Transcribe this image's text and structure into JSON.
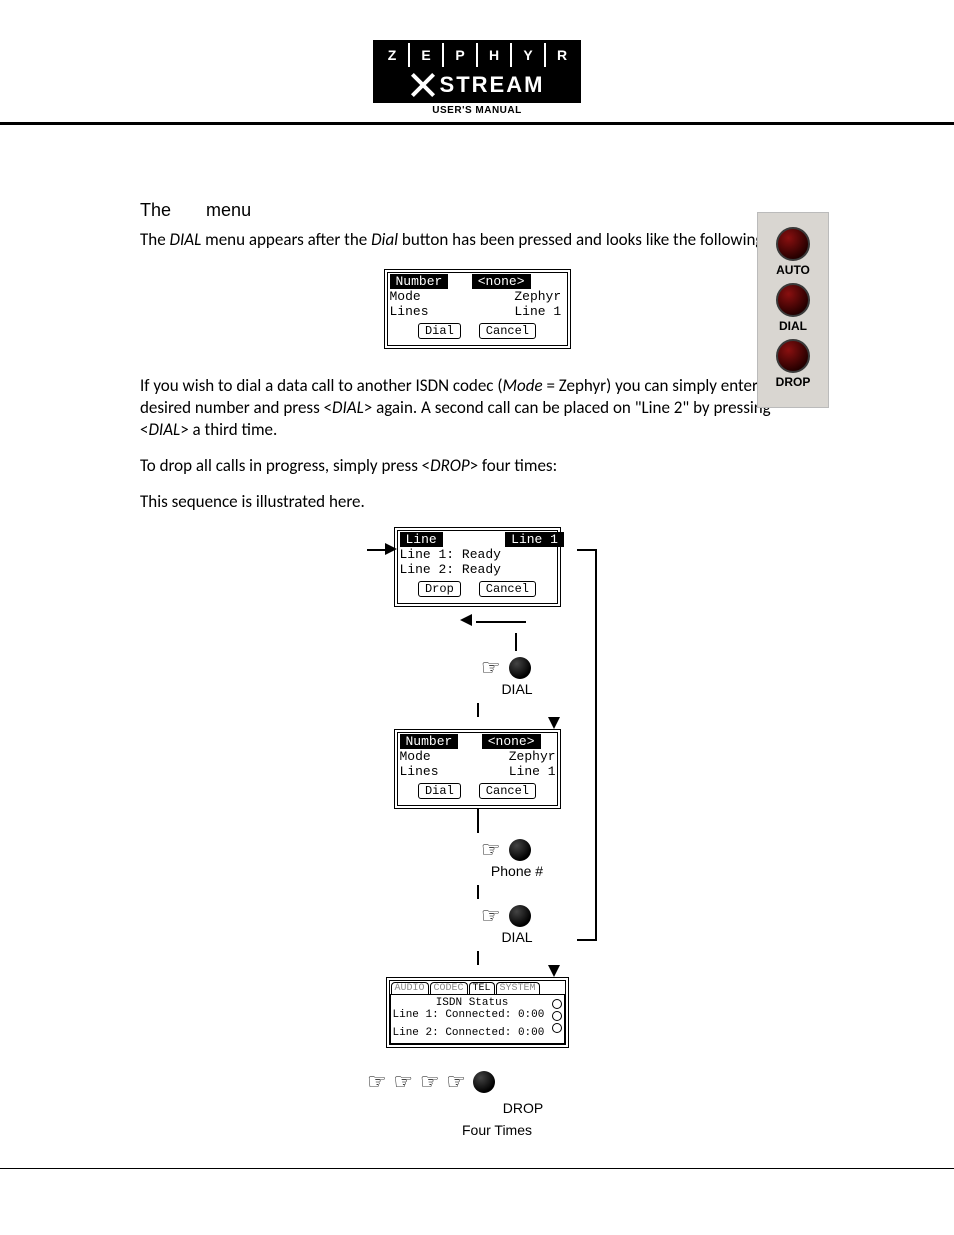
{
  "logo": {
    "letters": "ZEPHYR",
    "brand": "STREAM",
    "subtitle": "USER'S MANUAL"
  },
  "heading": {
    "the": "The",
    "menu": "menu"
  },
  "para1_a": "The ",
  "para1_b": "DIAL",
  "para1_c": " menu appears after the ",
  "para1_d": "Dial",
  "para1_e": " button has been pressed and looks like the following:",
  "lcd1": {
    "number_lbl": "Number",
    "number_val": "<none>",
    "mode_lbl": "Mode",
    "mode_val": "Zephyr",
    "lines_lbl": "Lines",
    "lines_val": "Line 1",
    "dial": "Dial",
    "cancel": "Cancel"
  },
  "side": {
    "auto": "AUTO",
    "dial": "DIAL",
    "drop": "DROP"
  },
  "para2_a": "If you wish to dial a data call to another ISDN codec (",
  "para2_b": "Mode",
  "para2_c": " = Zephyr) you can simply enter the desired number and press <",
  "para2_d": "DIAL",
  "para2_e": "> again.  A second call can be placed on \"Line 2\" by pressing <",
  "para2_f": "DIAL",
  "para2_g": "> a third time.",
  "para3_a": "To drop all calls in progress, simply press <",
  "para3_b": "DROP",
  "para3_c": "> four times:",
  "para4": "This sequence is illustrated here.",
  "flow": {
    "lcd_top": {
      "line_lbl": "Line",
      "line_val": "Line 1",
      "l1": "Line 1:",
      "l1v": "Ready",
      "l2": "Line 2:",
      "l2v": "Ready",
      "drop": "Drop",
      "cancel": "Cancel"
    },
    "step_dial": "DIAL",
    "step_phone": "Phone #",
    "lcd_status": {
      "tab_audio": "AUDIO",
      "tab_codec": "CODEC",
      "tab_tel": "TEL",
      "tab_system": "SYSTEM",
      "title": "ISDN Status",
      "l1": "Line 1:",
      "l1v": "Connected: 0:00",
      "l2": "Line 2:",
      "l2v": "Connected: 0:00"
    },
    "step_drop": "DROP",
    "four_times": "Four Times"
  }
}
